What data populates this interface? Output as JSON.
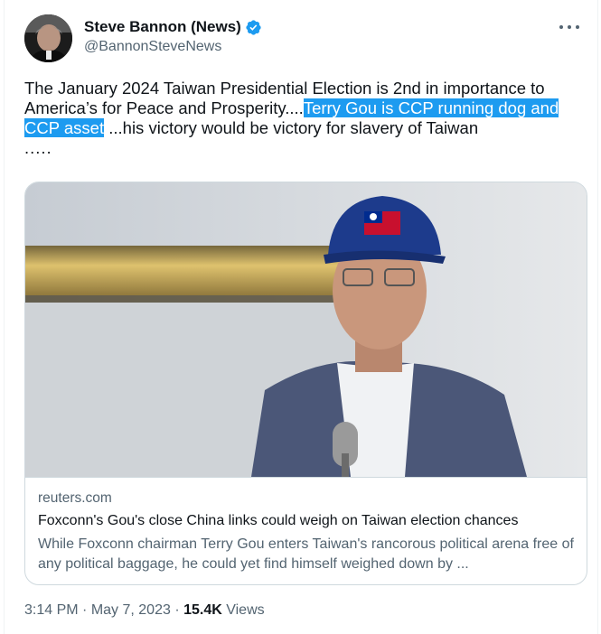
{
  "author": {
    "name": "Steve Bannon (News)",
    "handle": "@BannonSteveNews",
    "verified_color": "#1d9bf0"
  },
  "tweet": {
    "text_before": "The January 2024 Taiwan Presidential Election is 2nd in importance to America’s for Peace and Prosperity....",
    "text_highlight": "Terry Gou is CCP running dog and CCP asset",
    "text_after": " ...his victory would be victory for slavery of Taiwan",
    "text_trailing": ".....",
    "highlight_color": "#1d9bf0"
  },
  "link_card": {
    "domain": "reuters.com",
    "title": "Foxconn's Gou's close China links could weigh on Taiwan election chances",
    "description": "While Foxconn chairman Terry Gou enters Taiwan's rancorous political arena free of any political baggage, he could yet find himself weighed down by ...",
    "image_icon": "news-photo"
  },
  "meta": {
    "time": "3:14 PM",
    "separator": " · ",
    "date": "May 7, 2023",
    "views_count": "15.4K",
    "views_label": " Views"
  },
  "icons": {
    "more": "more-options-icon",
    "verified": "verified-badge-icon"
  }
}
